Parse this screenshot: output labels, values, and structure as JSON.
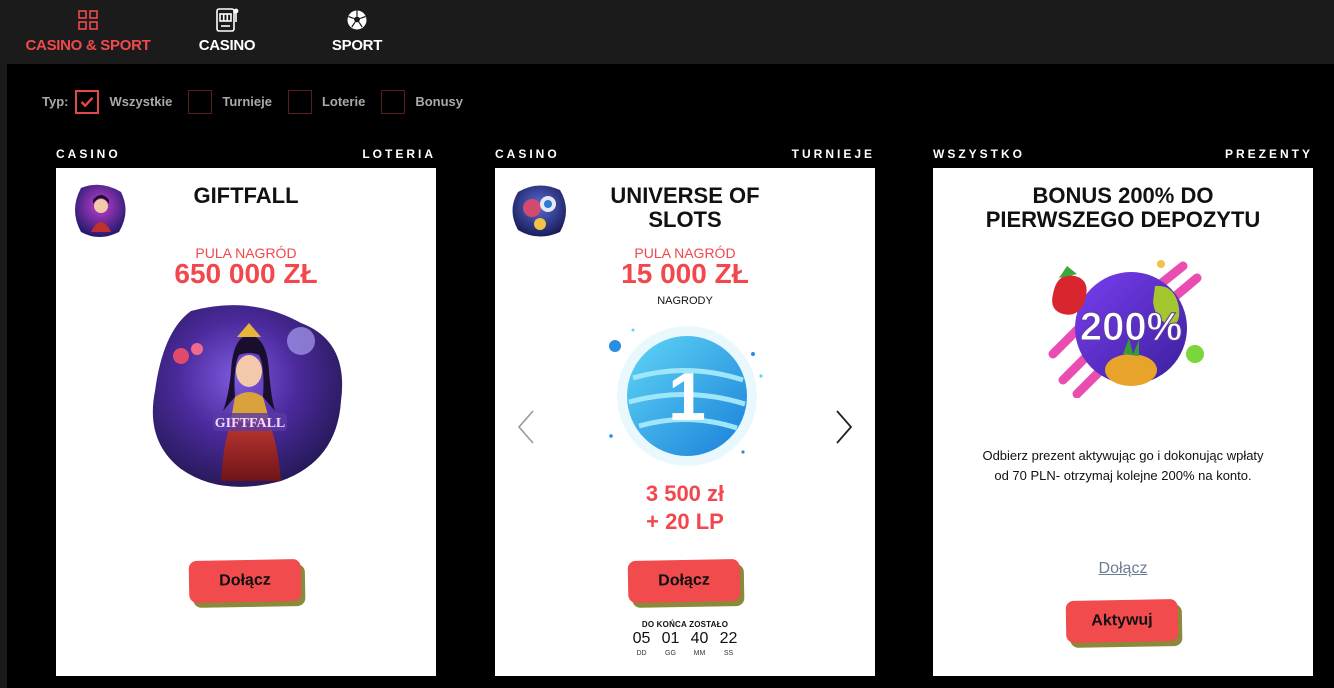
{
  "nav": {
    "items": [
      {
        "label": "CASINO & SPORT",
        "icon": "grid-icon",
        "active": true
      },
      {
        "label": "CASINO",
        "icon": "slot-machine-icon",
        "active": false
      },
      {
        "label": "SPORT",
        "icon": "soccer-ball-icon",
        "active": false
      }
    ]
  },
  "filters": {
    "label": "Typ:",
    "options": [
      {
        "label": "Wszystkie",
        "checked": true
      },
      {
        "label": "Turnieje",
        "checked": false
      },
      {
        "label": "Loterie",
        "checked": false
      },
      {
        "label": "Bonusy",
        "checked": false
      }
    ]
  },
  "cards": [
    {
      "category": "CASINO",
      "type": "LOTERIA",
      "title": "GIFTFALL",
      "pool_label": "PULA NAGRÓD",
      "pool_value": "650 000 ZŁ",
      "image_text": "GIFTFALL",
      "button": "Dołącz"
    },
    {
      "category": "CASINO",
      "type": "TURNIEJE",
      "title_line1": "UNIVERSE OF",
      "title_line2": "SLOTS",
      "pool_label": "PULA NAGRÓD",
      "pool_value": "15 000 ZŁ",
      "prizes_label": "NAGRODY",
      "place": "1",
      "prize_line1": "3 500 zł",
      "prize_line2": "+ 20 LP",
      "button": "Dołącz",
      "timer": {
        "label": "DO KOŃCA ZOSTAŁO",
        "units": [
          {
            "value": "05",
            "unit": "DD"
          },
          {
            "value": "01",
            "unit": "GG"
          },
          {
            "value": "40",
            "unit": "MM"
          },
          {
            "value": "22",
            "unit": "SS"
          }
        ]
      }
    },
    {
      "category": "WSZYSTKO",
      "type": "PREZENTY",
      "title_line1": "BONUS 200% DO",
      "title_line2": "PIERWSZEGO DEPOZYTU",
      "image_text": "200%",
      "desc_line1": "Odbierz prezent aktywując go i dokonując wpłaty",
      "desc_line2": "od 70 PLN- otrzymaj kolejne 200% na konto.",
      "link": "Dołącz",
      "button": "Aktywuj"
    }
  ],
  "colors": {
    "accent": "#f24b4d",
    "background": "#000000",
    "nav_bg": "#1b1b1b"
  }
}
